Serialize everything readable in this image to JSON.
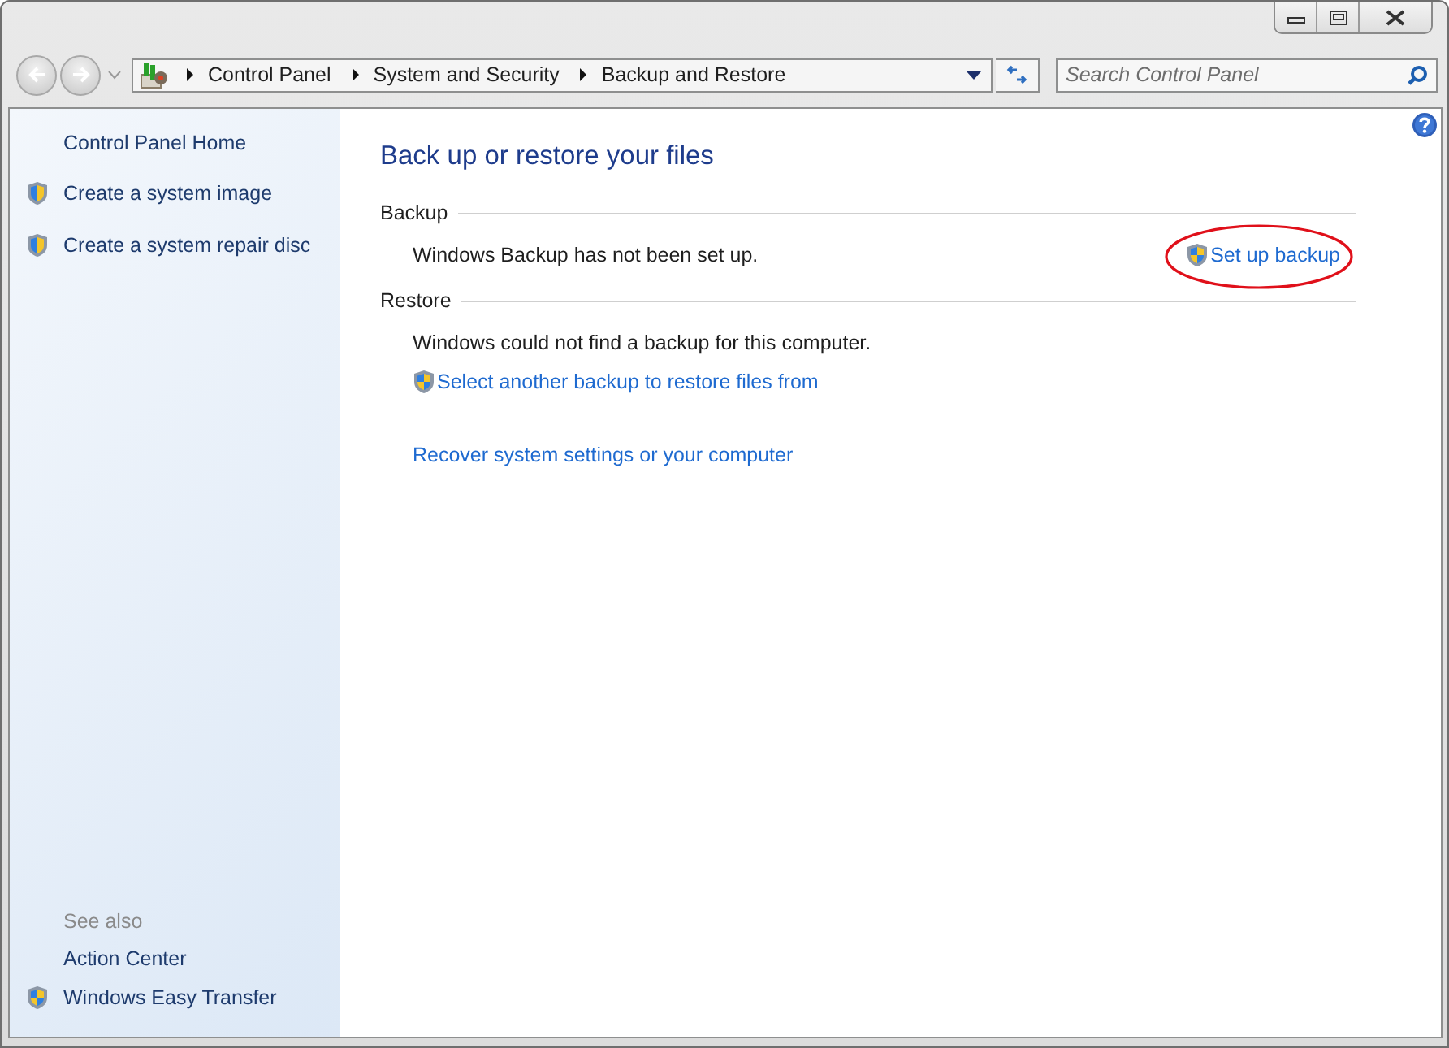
{
  "address_bar": {
    "breadcrumbs": [
      "Control Panel",
      "System and Security",
      "Backup and Restore"
    ]
  },
  "search": {
    "placeholder": "Search Control Panel"
  },
  "sidebar": {
    "home": "Control Panel Home",
    "tasks": [
      {
        "label": "Create a system image",
        "shield": true
      },
      {
        "label": "Create a system repair disc",
        "shield": true
      }
    ],
    "see_also": {
      "title": "See also",
      "items": [
        {
          "label": "Action Center",
          "shield": false
        },
        {
          "label": "Windows Easy Transfer",
          "shield": true
        }
      ]
    }
  },
  "main": {
    "title": "Back up or restore your files",
    "sections": [
      {
        "heading": "Backup",
        "message": "Windows Backup has not been set up.",
        "action": {
          "label": "Set up backup",
          "shield": true,
          "circled": true
        }
      },
      {
        "heading": "Restore",
        "message": "Windows could not find a backup for this computer.",
        "links": [
          {
            "label": "Select another backup to restore files from",
            "shield": true
          }
        ]
      }
    ],
    "footer_link": {
      "label": "Recover system settings or your computer"
    }
  }
}
